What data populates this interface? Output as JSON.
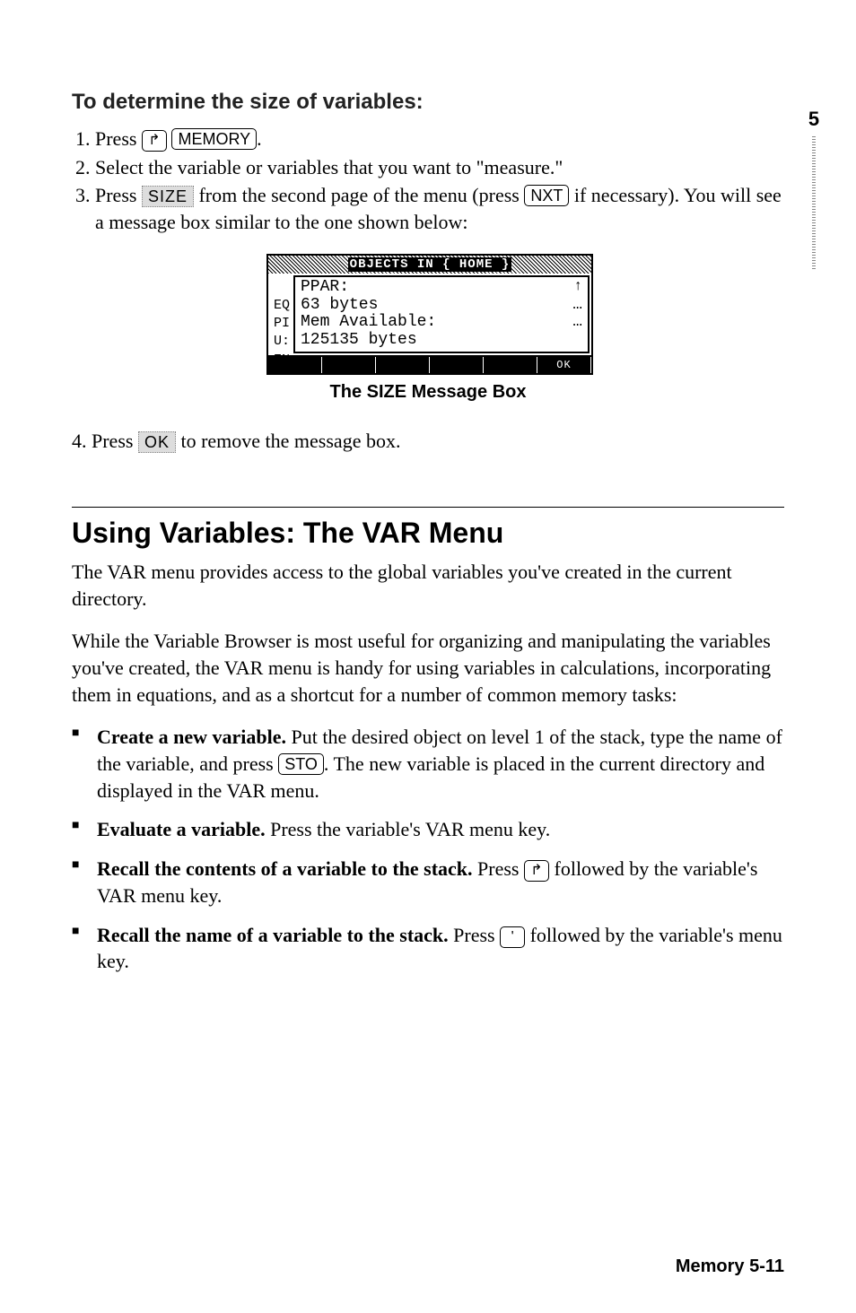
{
  "chapterTab": "5",
  "section1Title": "To determine the size of variables:",
  "steps": {
    "s1a": "Press ",
    "s1_shift": "↱",
    "s1_key": "MEMORY",
    "s1b": ".",
    "s2": "Select the variable or variables that you want to \"measure.\"",
    "s3a": "Press ",
    "s3_soft": "SIZE",
    "s3b": " from the second page of the menu (press ",
    "s3_key": "NXT",
    "s3c": " if necessary). You will see a message box similar to the one shown below:"
  },
  "screen": {
    "titlebar": "OBJECTS IN { HOME }",
    "sideLabels": [
      "EQ",
      "PI",
      "U:",
      "EN"
    ],
    "line1": "PPAR:",
    "arrow": "↑",
    "line2": "  63 bytes",
    "dots2": "…",
    "line3": "Mem Available:",
    "dots3": "…",
    "line4": "  125135 bytes",
    "ok": "OK"
  },
  "caption": "The SIZE Message Box",
  "step4": {
    "num": "4.",
    "a": "Press ",
    "soft": "OK",
    "b": " to remove the message box."
  },
  "h2": "Using Variables: The VAR Menu",
  "p1": "The VAR menu provides access to the global variables you've created in the current directory.",
  "p2": "While the Variable Browser is most useful for organizing and manipulating the variables you've created, the VAR menu is handy for using variables in calculations, incorporating them in equations, and as a shortcut for a number of common memory tasks:",
  "bullets": {
    "b1_bold": "Create a new variable.",
    "b1a": " Put the desired object on level 1 of the stack, type the name of the variable, and press ",
    "b1_key": "STO",
    "b1b": ". The new variable is placed in the current directory and displayed in the VAR menu.",
    "b2_bold": "Evaluate a variable.",
    "b2a": " Press the variable's VAR menu key.",
    "b3_bold": "Recall the contents of a variable to the stack.",
    "b3a": " Press ",
    "b3_shift": "↱",
    "b3b": " followed by the variable's VAR menu key.",
    "b4_bold": "Recall the name of a variable to the stack.",
    "b4a": " Press ",
    "b4_shift": "'",
    "b4b": " followed by the variable's menu key."
  },
  "footer": "Memory   5-11"
}
